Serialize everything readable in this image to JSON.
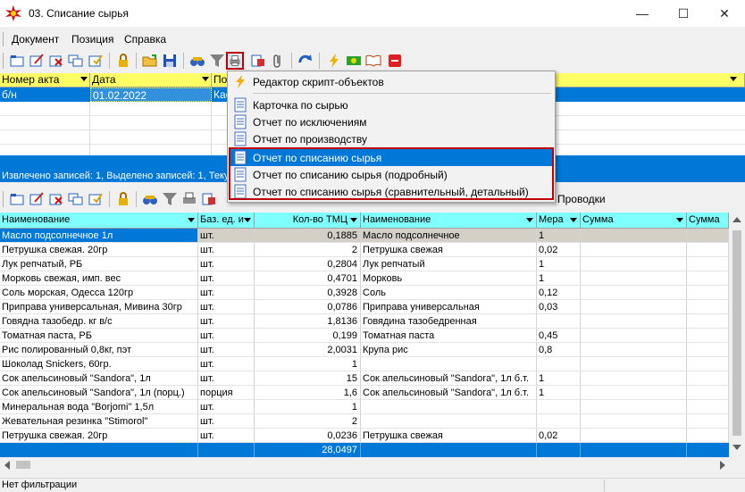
{
  "window": {
    "title": "03. Списание сырья",
    "minimize": "—",
    "maximize": "☐",
    "close": "✕"
  },
  "menu": [
    "Документ",
    "Позиция",
    "Справка"
  ],
  "colors": {
    "accent": "#0078d7",
    "header_yellow": "#ffff66",
    "header_cyan": "#80ffff",
    "highlight_border": "#c00000"
  },
  "top_grid": {
    "columns": [
      "Номер акта",
      "Дата",
      "По"
    ],
    "row": {
      "number": "б/н",
      "date": "01.02.2022",
      "third": "Кас"
    },
    "status": "Извлечено записей: 1, Выделено записей: 1, Теку"
  },
  "lower_toolbar_label": "Проводки",
  "popup_menu": {
    "items": [
      {
        "label": "Редактор скрипт-объектов",
        "icon": "lightning-icon"
      },
      {
        "label": "Карточка по сырью",
        "icon": "document-icon"
      },
      {
        "label": "Отчет по исключениям",
        "icon": "document-icon"
      },
      {
        "label": "Отчет по производству",
        "icon": "document-icon"
      },
      {
        "label": "Отчет по списанию сырья",
        "icon": "document-icon"
      },
      {
        "label": "Отчет по списанию сырья (подробный)",
        "icon": "document-icon"
      },
      {
        "label": "Отчет по списанию сырья (сравнительный, детальный)",
        "icon": "document-icon"
      }
    ]
  },
  "bottom_grid": {
    "columns": [
      "Наименование",
      "Баз. ед. и",
      "Кол-во ТМЦ",
      "Наименование",
      "Мера",
      "Сумма",
      "Сумма"
    ],
    "rows": [
      [
        "Масло подсолнечное 1л",
        "шт.",
        "0,1885",
        "Масло подсолнечное",
        "1",
        "",
        ""
      ],
      [
        "Петрушка свежая. 20гр",
        "шт.",
        "2",
        "Петрушка свежая",
        "0,02",
        "",
        ""
      ],
      [
        "Лук репчатый, РБ",
        "шт.",
        "0,2804",
        "Лук репчатый",
        "1",
        "",
        ""
      ],
      [
        "Морковь свежая, имп. вес",
        "шт.",
        "0,4701",
        "Морковь",
        "1",
        "",
        ""
      ],
      [
        "Соль морская, Одесса 120гр",
        "шт.",
        "0,3928",
        "Соль",
        "0,12",
        "",
        ""
      ],
      [
        "Приправа универсальная, Мивина 30гр",
        "шт.",
        "0,0786",
        "Приправа универсальная",
        "0,03",
        "",
        ""
      ],
      [
        "Говядна тазобедр. кг в/с",
        "шт.",
        "1,8136",
        "Говядина тазобедренная",
        "",
        "",
        ""
      ],
      [
        "Томатная паста, РБ",
        "шт.",
        "0,199",
        "Томатная паста",
        "0,45",
        "",
        ""
      ],
      [
        "Рис полированный 0,8кг, пэт",
        "шт.",
        "2,0031",
        "Крупа рис",
        "0,8",
        "",
        ""
      ],
      [
        "Шоколад Snickers, 60гр.",
        "шт.",
        "1",
        "",
        "",
        "",
        ""
      ],
      [
        "Сок апельсиновый \"Sandora\", 1л",
        "шт.",
        "15",
        "Сок апельсиновый \"Sandora\", 1л б.т.",
        "1",
        "",
        ""
      ],
      [
        "Сок апельсиновый \"Sandora\", 1л (порц.)",
        "порция",
        "1,6",
        "Сок апельсиновый \"Sandora\", 1л б.т.",
        "1",
        "",
        ""
      ],
      [
        "Минеральная вода \"Borjomi\" 1,5л",
        "шт.",
        "1",
        "",
        "",
        "",
        ""
      ],
      [
        "Жевательная резинка \"Stimorol\"",
        "шт.",
        "2",
        "",
        "",
        "",
        ""
      ],
      [
        "Петрушка свежая. 20гр",
        "шт.",
        "0,0236",
        "Петрушка свежая",
        "0,02",
        "",
        ""
      ]
    ],
    "total_qty": "28,0497"
  },
  "statusbar": {
    "text": "Нет фильтрации"
  }
}
